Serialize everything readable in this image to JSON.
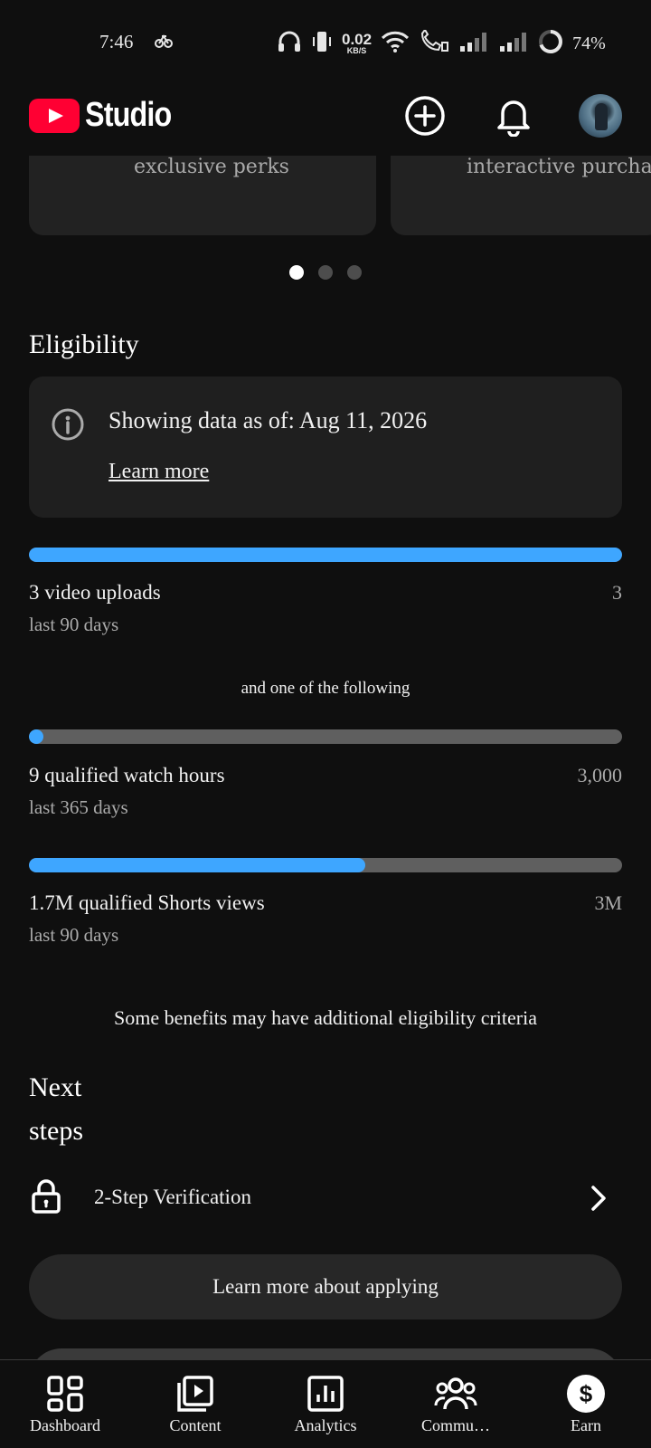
{
  "status_bar": {
    "time": "7:46",
    "net_speed_value": "0.02",
    "net_speed_unit": "KB/S",
    "battery": "74%"
  },
  "header": {
    "app_name": "Studio",
    "avatar_alt": "Channel avatar"
  },
  "carousel": {
    "cards": [
      {
        "text": "exclusive perks"
      },
      {
        "text": "interactive purchases"
      }
    ],
    "active_index": 0,
    "count": 3
  },
  "eligibility": {
    "title": "Eligibility",
    "info_text": "Showing data as of: Aug 11, 2026",
    "learn_more": "Learn more",
    "metrics": [
      {
        "label": "3 video uploads",
        "sub": "last 90 days",
        "target": "3",
        "progress": 1.0
      },
      {
        "label": "9 qualified watch hours",
        "sub": "last 365 days",
        "target": "3,000",
        "progress": 0.003
      },
      {
        "label": "1.7M qualified Shorts views",
        "sub": "last 90 days",
        "target": "3M",
        "progress": 0.5667
      }
    ],
    "separator": "and one of the following",
    "note": "Some benefits may have additional eligibility criteria"
  },
  "next_steps": {
    "title_line1": "Next",
    "title_line2": "steps",
    "item": "2-Step Verification"
  },
  "buttons": {
    "learn_more_applying": "Learn more about applying"
  },
  "bottom_nav": [
    {
      "label": "Dashboard"
    },
    {
      "label": "Content"
    },
    {
      "label": "Analytics"
    },
    {
      "label": "Commu…"
    },
    {
      "label": "Earn"
    }
  ],
  "colors": {
    "accent": "#3ea6ff",
    "brand": "#ff0033",
    "background": "#0f0f0f",
    "track": "#5f5f5f"
  }
}
